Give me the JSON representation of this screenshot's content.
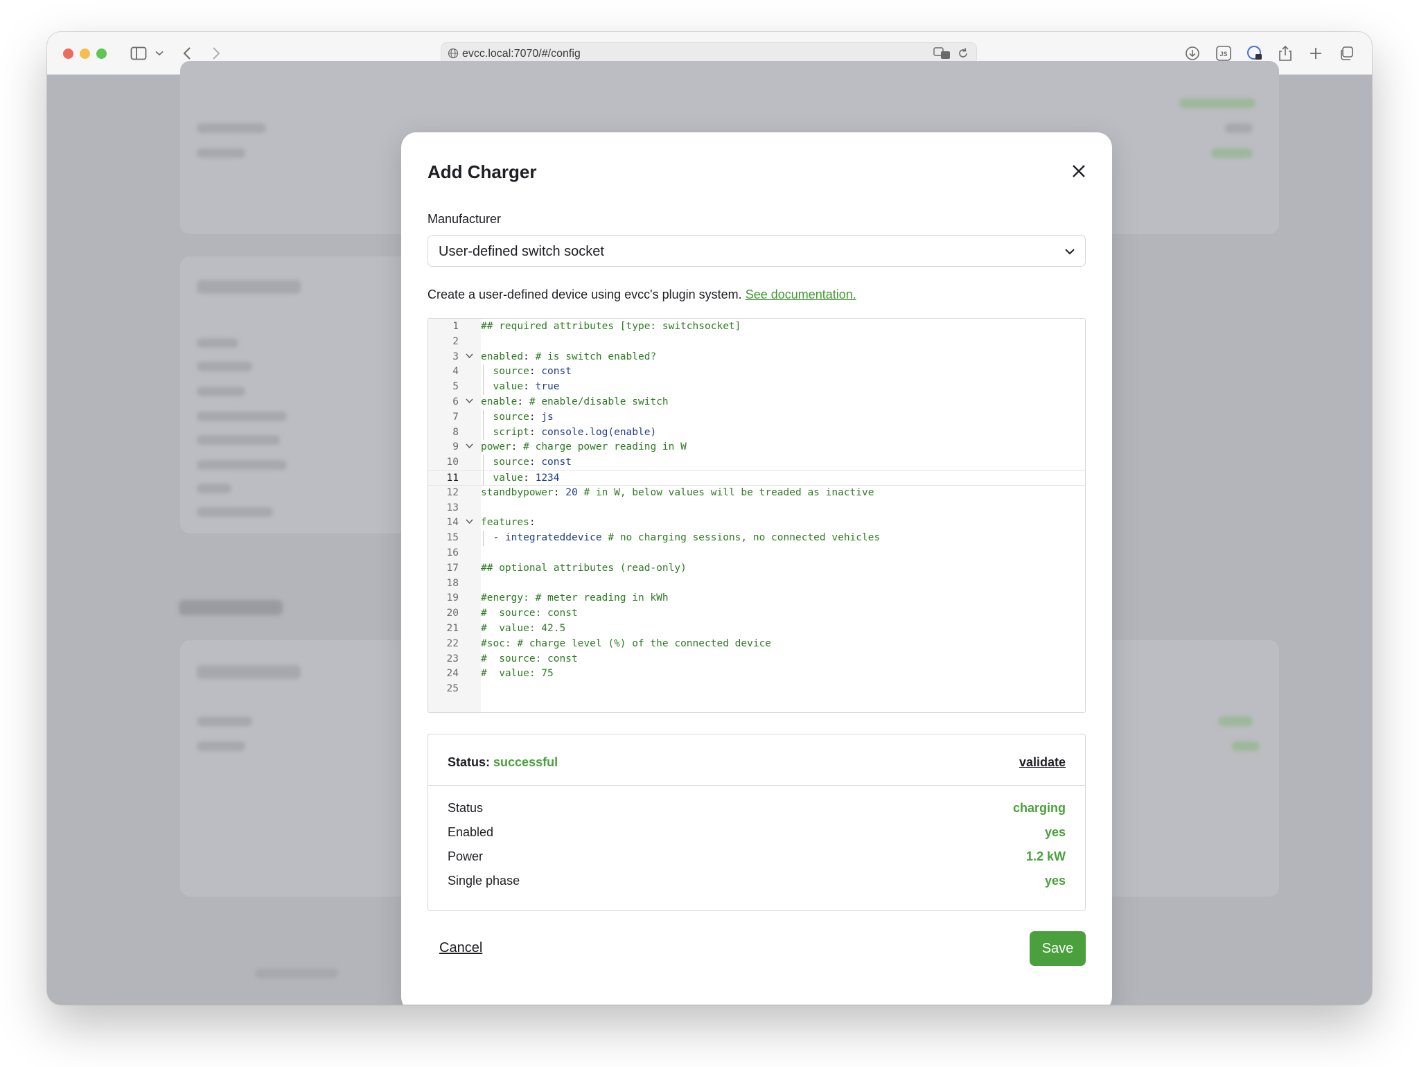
{
  "browser": {
    "url": "evcc.local:7070/#/config"
  },
  "modal": {
    "title": "Add Charger",
    "manufacturer_label": "Manufacturer",
    "manufacturer_value": "User-defined switch socket",
    "description": "Create a user-defined device using evcc's plugin system.",
    "doc_link": "See documentation.",
    "cancel_label": "Cancel",
    "save_label": "Save"
  },
  "editor": {
    "active_line": 11,
    "lines": [
      "## required attributes [type: switchsocket]",
      "",
      "enabled: # is switch enabled?",
      "  source: const",
      "  value: true",
      "enable: # enable/disable switch",
      "  source: js",
      "  script: console.log(enable)",
      "power: # charge power reading in W",
      "  source: const",
      "  value: 1234",
      "standbypower: 20 # in W, below values will be treaded as inactive",
      "",
      "features:",
      "  - integrateddevice # no charging sessions, no connected vehicles",
      "",
      "## optional attributes (read-only)",
      "",
      "#energy: # meter reading in kWh",
      "#  source: const",
      "#  value: 42.5",
      "#soc: # charge level (%) of the connected device",
      "#  source: const",
      "#  value: 75",
      ""
    ]
  },
  "status": {
    "label": "Status:",
    "value": "successful",
    "validate_label": "validate",
    "rows": [
      {
        "key": "Status",
        "value": "charging"
      },
      {
        "key": "Enabled",
        "value": "yes"
      },
      {
        "key": "Power",
        "value": "1.2 kW"
      },
      {
        "key": "Single phase",
        "value": "yes"
      }
    ]
  },
  "colors": {
    "accent": "#4aa03c",
    "overlay": "#b4b5ba"
  }
}
